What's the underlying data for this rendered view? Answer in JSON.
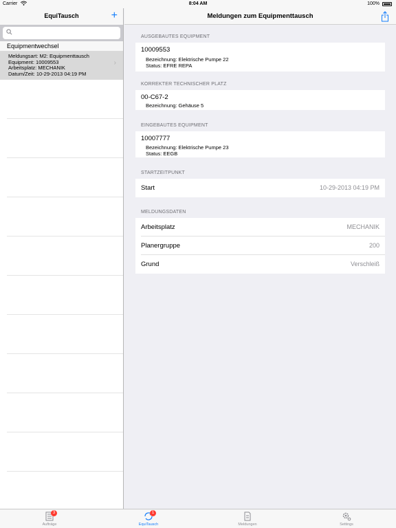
{
  "status_bar": {
    "carrier": "Carrier",
    "time": "8:04 AM",
    "battery": "100%"
  },
  "left": {
    "title": "EquiTausch",
    "add_label": "+",
    "search_placeholder": "",
    "section_title": "Equipmentwechsel",
    "item": {
      "line1": "Meldungsart: M2: Equipmenttausch",
      "line2": "Equipment: 10009553",
      "line3": "Arbeitsplatz: MECHANIK",
      "line4": "Datum/Zeit: 10-29-2013 04:19 PM"
    }
  },
  "right": {
    "title": "Meldungen zum Equipmenttausch",
    "removed": {
      "header": "AUSGEBAUTES EQUIPMENT",
      "number": "10009553",
      "desc": "Bezeichnung: Elektrische Pumpe 22",
      "status": "Status: EFRE REPA"
    },
    "location": {
      "header": "KORREKTER TECHNISCHER PLATZ",
      "number": "00-C67-2",
      "desc": "Bezeichnung: Gehäuse 5"
    },
    "installed": {
      "header": "EINGEBAUTES EQUIPMENT",
      "number": "10007777",
      "desc": "Bezeichnung: Elektrische Pumpe 23",
      "status": "Status: EEGB"
    },
    "start": {
      "header": "STARTZEITPUNKT",
      "label": "Start",
      "value": "10-29-2013 04:19 PM"
    },
    "report": {
      "header": "MELDUNGSDATEN",
      "rows": [
        {
          "label": "Arbeitsplatz",
          "value": "MECHANIK"
        },
        {
          "label": "Planergruppe",
          "value": "200"
        },
        {
          "label": "Grund",
          "value": "Verschleiß"
        }
      ]
    }
  },
  "tabs": [
    {
      "label": "Aufträge",
      "badge": "3"
    },
    {
      "label": "EquiTausch",
      "badge": "1"
    },
    {
      "label": "Meldungen"
    },
    {
      "label": "Settings"
    }
  ],
  "colors": {
    "accent": "#147efb",
    "badge": "#ff3b30",
    "selected_row": "#d9d9d9"
  }
}
